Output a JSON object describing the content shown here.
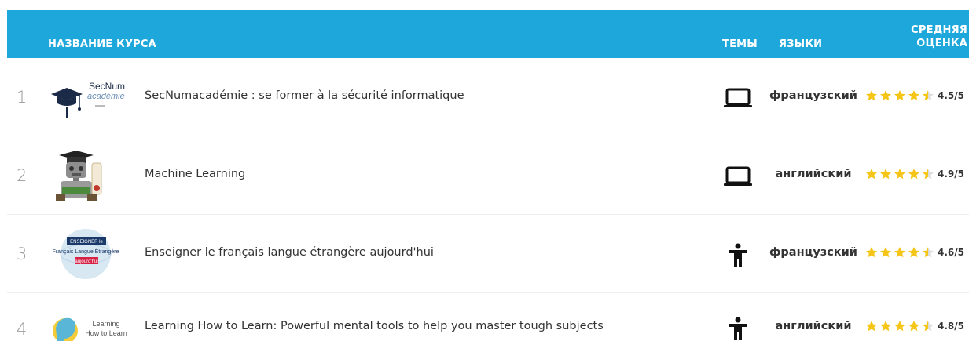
{
  "header": {
    "col_name": "НАЗВАНИЕ КУРСА",
    "col_topics": "ТЕМЫ",
    "col_languages": "ЯЗЫКИ",
    "col_rating_line1": "СРЕДНЯЯ",
    "col_rating_line2": "ОЦЕНКА",
    "background": "#1ea7db"
  },
  "rows": [
    {
      "number": "1",
      "title": "SecNumacadémie : se former à la sécurité informatique",
      "topic_icon": "laptop-icon",
      "language": "французский",
      "rating": 4.5,
      "rating_text": "4.5/5",
      "logo": {
        "name": "secnum-logo",
        "line1": "SecNum",
        "line2": "académie"
      }
    },
    {
      "number": "2",
      "title": "Machine Learning",
      "topic_icon": "laptop-icon",
      "language": "английский",
      "rating": 4.9,
      "rating_text": "4.9/5",
      "logo": {
        "name": "robot-graduate-logo"
      }
    },
    {
      "number": "3",
      "title": "Enseigner le français langue étrangère aujourd'hui",
      "topic_icon": "person-icon",
      "language": "французский",
      "rating": 4.6,
      "rating_text": "4.6/5",
      "logo": {
        "name": "fle-logo",
        "line1": "ENSEIGNER le",
        "line2": "Français Langue Étrangère",
        "line3": "aujourd'hui"
      }
    },
    {
      "number": "4",
      "title": "Learning How to Learn: Powerful mental tools to help you master tough subjects",
      "topic_icon": "person-icon",
      "language": "английский",
      "rating": 4.8,
      "rating_text": "4.8/5",
      "logo": {
        "name": "lhtl-logo",
        "line1": "Learning",
        "line2": "How to Learn"
      }
    }
  ],
  "colors": {
    "star_filled": "#f5c518",
    "star_empty": "#dddddd"
  }
}
